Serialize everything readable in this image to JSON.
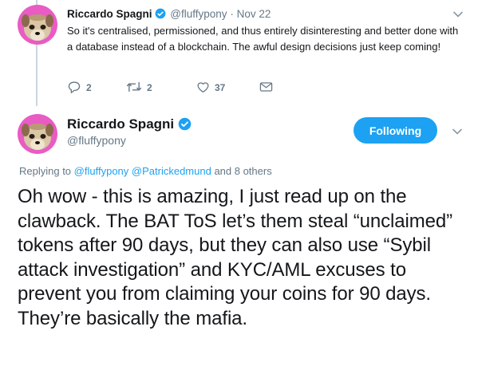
{
  "parent_tweet": {
    "author_name": "Riccardo Spagni",
    "author_handle": "@fluffypony",
    "separator": "·",
    "date": "Nov 22",
    "text": "So it's centralised, permissioned, and thus entirely disinteresting and better done with a database instead of a blockchain. The awful design decisions just keep coming!",
    "actions": {
      "reply_count": "2",
      "retweet_count": "2",
      "like_count": "37"
    }
  },
  "main_tweet": {
    "author_name": "Riccardo Spagni",
    "author_handle": "@fluffypony",
    "follow_label": "Following",
    "replying": {
      "prefix": "Replying to",
      "mention1": "@fluffypony",
      "mention2": "@Patrickedmund",
      "suffix": "and 8 others"
    },
    "text": "Oh wow - this is amazing, I just read up on the clawback. The BAT ToS let’s them steal “unclaimed” tokens after 90 days, but they can also use “Sybil attack investigation” and KYC/AML excuses to prevent you from claiming your coins for 90 days. They’re basically the mafia."
  },
  "colors": {
    "accent": "#1da1f2",
    "muted": "#657786",
    "avatar_bg": "#e85cc3"
  }
}
